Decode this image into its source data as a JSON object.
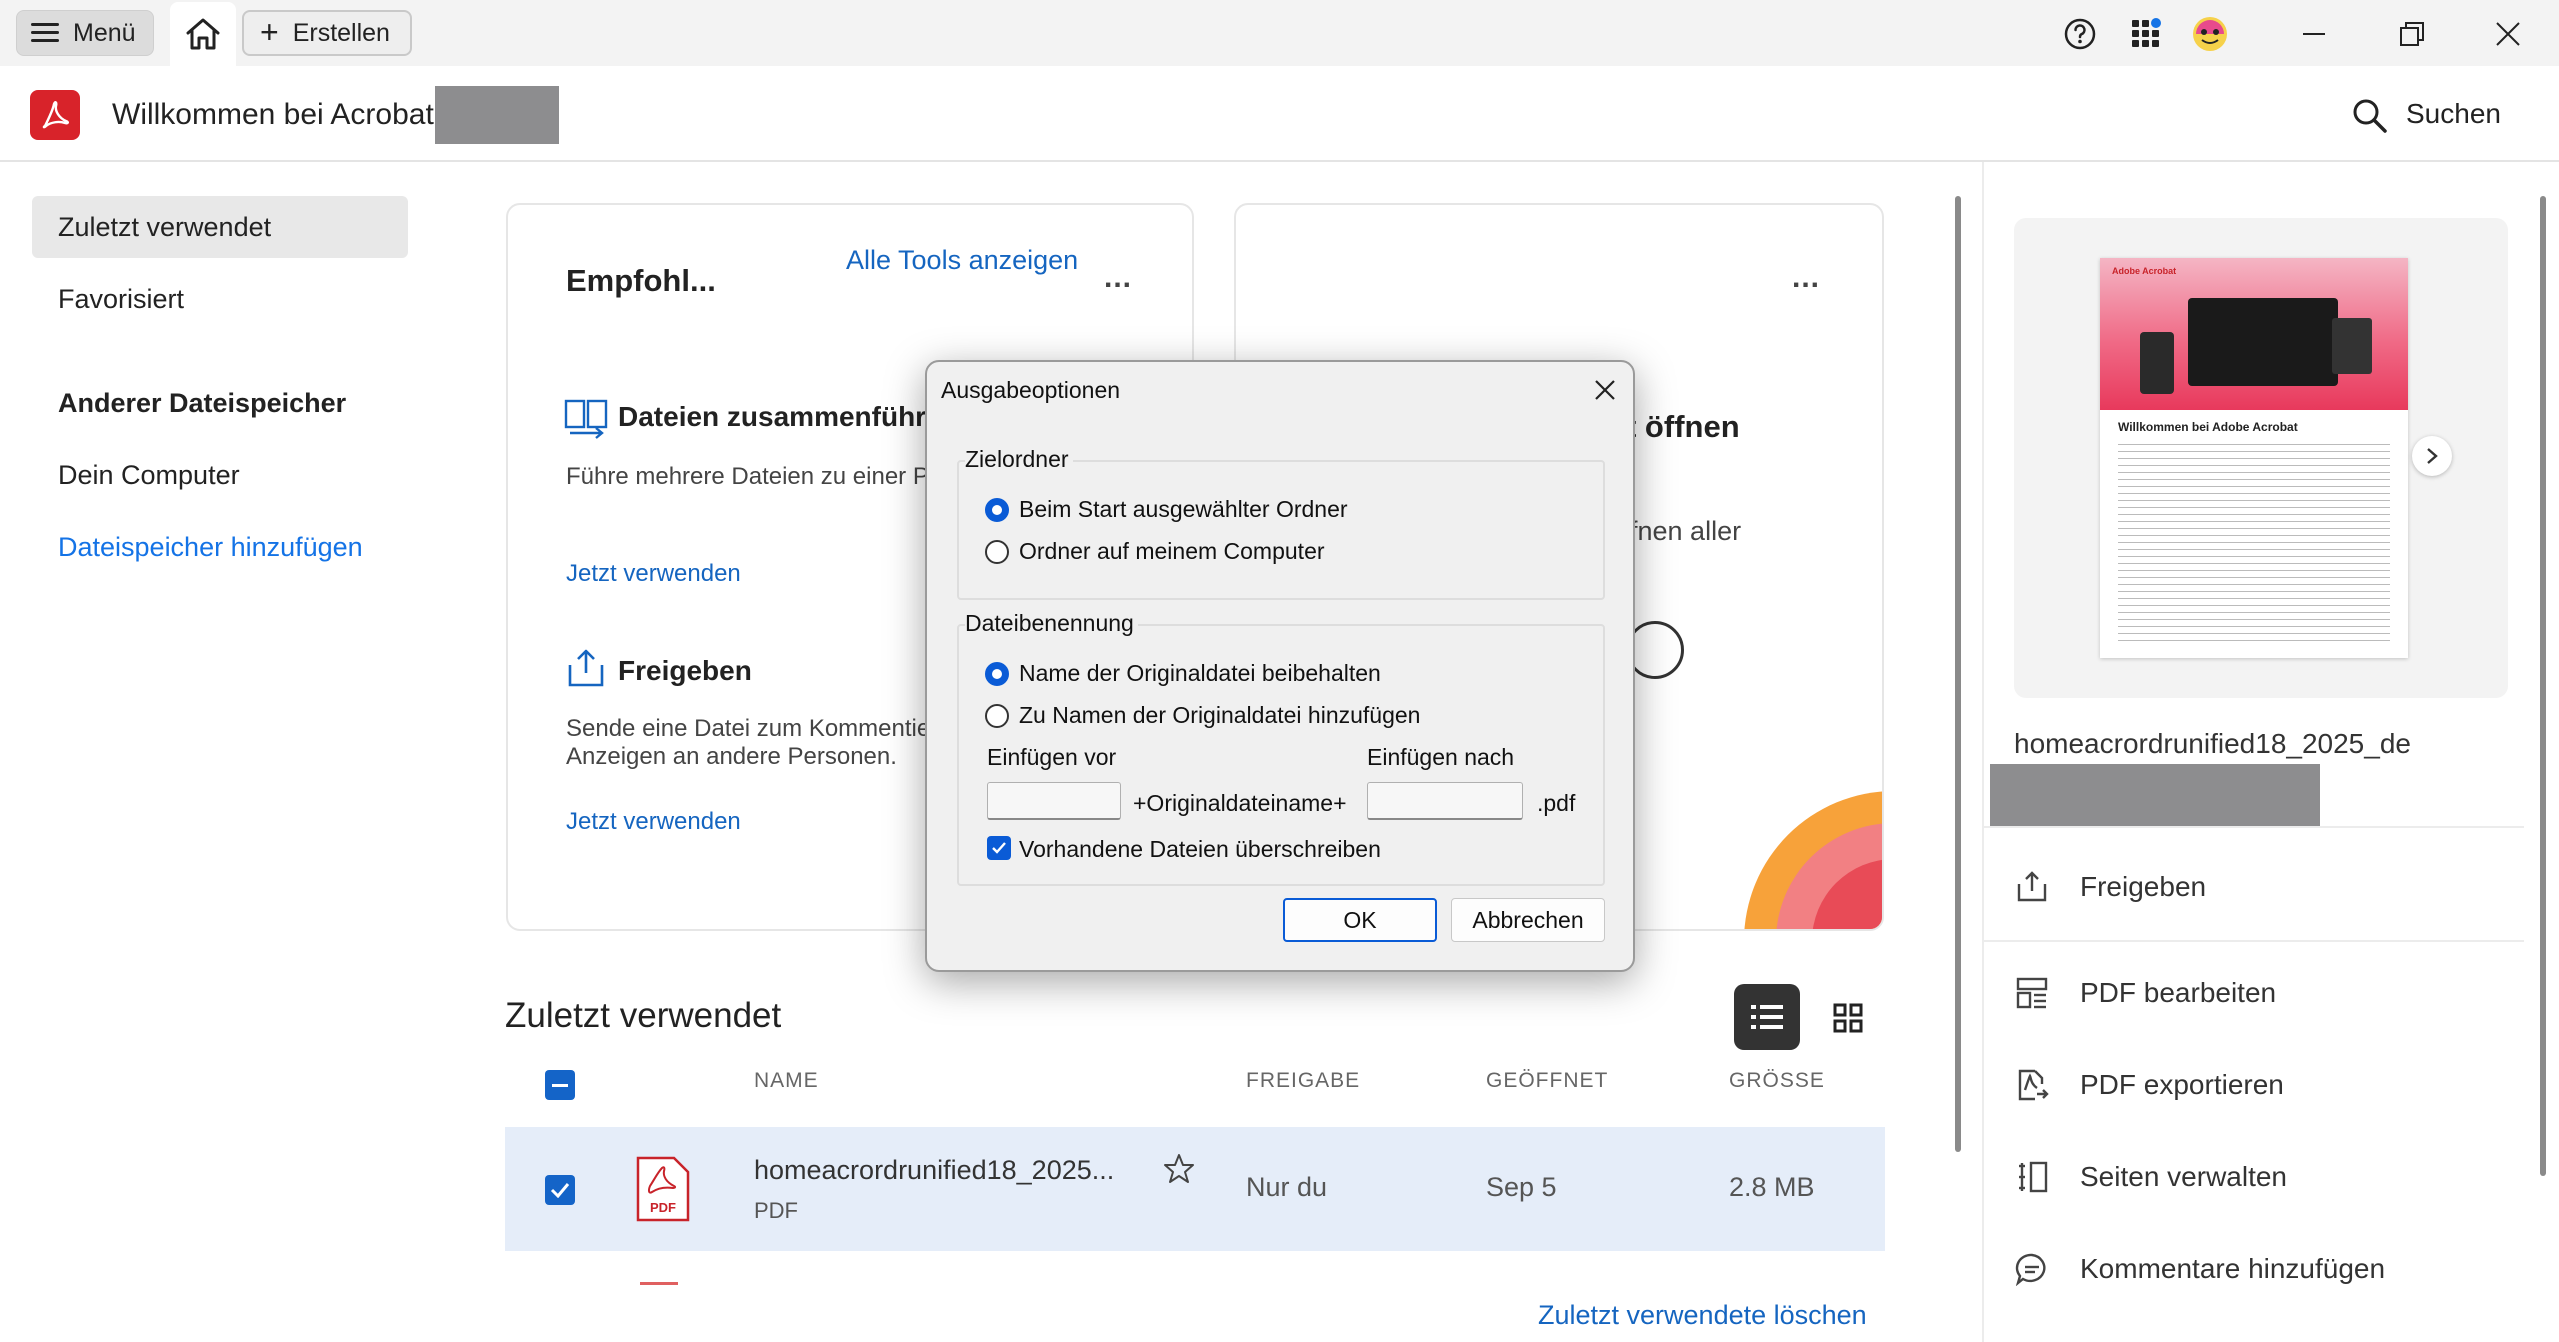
{
  "topbar": {
    "menu_label": "Menü",
    "create_label": "Erstellen"
  },
  "header": {
    "welcome": "Willkommen bei Acrobat",
    "search_label": "Suchen"
  },
  "nav": {
    "recent": "Zuletzt verwendet",
    "favorites": "Favorisiert",
    "other_storage_heading": "Anderer Dateispeicher",
    "my_computer": "Dein Computer",
    "add_storage": "Dateispeicher hinzufügen"
  },
  "card_recommended": {
    "title": "Empfohl...",
    "all_tools": "Alle Tools anzeigen",
    "more": "...",
    "tool1_name": "Dateien zusammenführ",
    "tool1_desc": "Führe mehrere Dateien zu einer P",
    "tool1_link": "Jetzt verwenden",
    "tool2_name": "Freigeben",
    "tool2_desc_line1": "Sende eine Datei zum Kommentie",
    "tool2_desc_line2": "Anzeigen an andere Personen.",
    "tool2_link": "Jetzt verwenden"
  },
  "card_second": {
    "more": "...",
    "title_fragment": "t öffnen",
    "desc_fragment": "fnen aller"
  },
  "recent_section": {
    "title": "Zuletzt verwendet",
    "columns": {
      "name": "NAME",
      "share": "FREIGABE",
      "opened": "GEÖFFNET",
      "size": "GRÖSSE"
    },
    "rows": [
      {
        "name": "homeacrordrunified18_2025...",
        "type": "PDF",
        "share": "Nur du",
        "opened": "Sep 5",
        "size": "2.8 MB",
        "icon_label": "PDF"
      }
    ],
    "clear_link": "Zuletzt verwendete löschen"
  },
  "right_panel": {
    "file_title": "homeacrordrunified18_2025_de",
    "thumb_brand": "Adobe Acrobat",
    "thumb_heading": "Willkommen bei Adobe Acrobat",
    "actions": [
      {
        "label": "Freigeben",
        "icon": "share-icon"
      },
      {
        "label": "PDF bearbeiten",
        "icon": "edit-pdf-icon"
      },
      {
        "label": "PDF exportieren",
        "icon": "export-pdf-icon"
      },
      {
        "label": "Seiten verwalten",
        "icon": "organize-pages-icon"
      },
      {
        "label": "Kommentare hinzufügen",
        "icon": "comment-icon"
      }
    ]
  },
  "dialog": {
    "title": "Ausgabeoptionen",
    "folder_group": "Zielordner",
    "folder_opt1": "Beim Start ausgewählter Ordner",
    "folder_opt2": "Ordner auf meinem Computer",
    "naming_group": "Dateibenennung",
    "naming_opt1": "Name der Originaldatei beibehalten",
    "naming_opt2": "Zu Namen der Originaldatei hinzufügen",
    "insert_before": "Einfügen vor",
    "insert_after": "Einfügen nach",
    "original_name": "+Originaldateiname+",
    "ext": ".pdf",
    "overwrite": "Vorhandene Dateien überschreiben",
    "ok": "OK",
    "cancel": "Abbrechen"
  },
  "colors": {
    "accent_blue": "#1473e6",
    "acrobat_red": "#d8232a",
    "selected_row": "#e5edf9"
  }
}
